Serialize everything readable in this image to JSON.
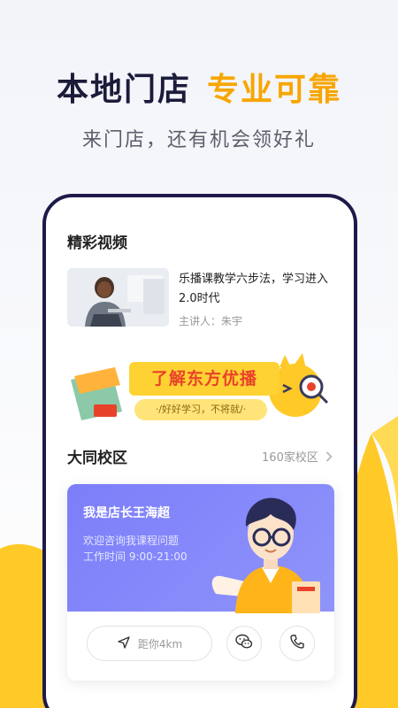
{
  "hero": {
    "title_part1": "本地门店",
    "title_part2": "专业可靠",
    "subtitle": "来门店，还有机会领好礼"
  },
  "featured": {
    "section_title": "精彩视频",
    "video": {
      "title": "乐播课教学六步法，学习进入2.0时代",
      "speaker": "主讲人：朱宇"
    }
  },
  "banner": {
    "main_text": "了解东方优播",
    "slogan": "·/好好学习，不将就/·"
  },
  "campus": {
    "name": "大同校区",
    "count_link": "160家校区",
    "chevron_icon": "chevron-right-icon"
  },
  "manager_card": {
    "name": "我是店长王海超",
    "desc_line1": "欢迎咨询我课程问题",
    "desc_line2": "工作时间 9:00-21:00",
    "distance_label": "距你4km",
    "icons": [
      "navigation-arrow-icon",
      "wechat-icon",
      "phone-icon"
    ]
  },
  "colors": {
    "accent_yellow": "#f7a600",
    "title_dark": "#1b1c3a",
    "phone_frame": "#1d1a4a",
    "card_purple": "#7c7ef9"
  }
}
